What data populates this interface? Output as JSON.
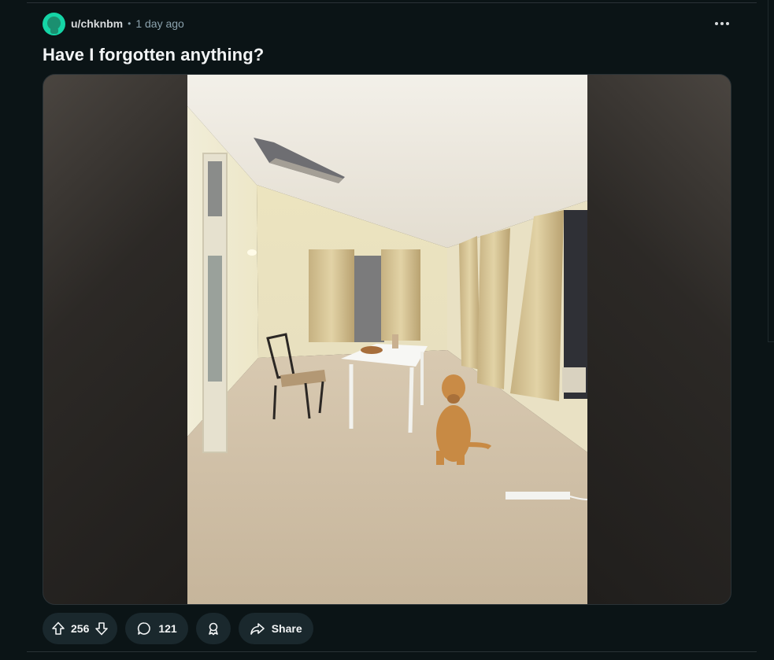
{
  "post": {
    "author": "u/chknbm",
    "separator": "•",
    "time_ago": "1 day ago",
    "title": "Have I forgotten anything?",
    "avatar_color": "#15d4a6"
  },
  "actions": {
    "score": "256",
    "comments": "121",
    "share_label": "Share"
  },
  "colors": {
    "background": "#0b1416",
    "pill": "#1a282d",
    "text": "#f2f4f5",
    "muted": "#8ba2ad"
  },
  "icons": {
    "overflow": "more-horizontal-icon",
    "upvote": "arrow-up-icon",
    "downvote": "arrow-down-icon",
    "comment": "chat-bubble-icon",
    "award": "award-icon",
    "share": "share-arrow-icon"
  }
}
